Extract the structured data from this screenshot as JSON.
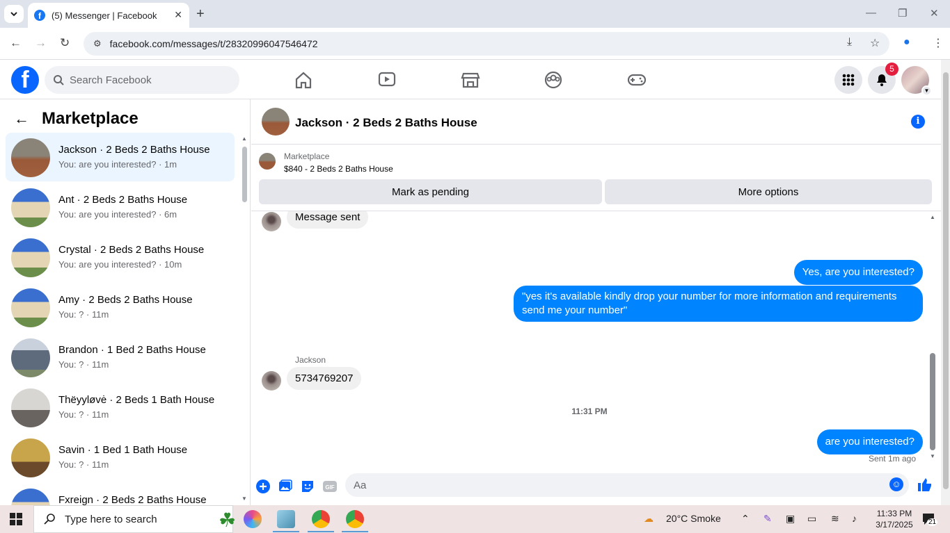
{
  "browser": {
    "tab_title": "(5) Messenger | Facebook",
    "url": "facebook.com/messages/t/28320996047546472"
  },
  "fb": {
    "search_placeholder": "Search Facebook",
    "notification_count": "5",
    "brand_color": "#0866ff"
  },
  "sidebar": {
    "title": "Marketplace",
    "conversations": [
      {
        "name": "Jackson · 2 Beds 2 Baths House",
        "snippet": "You: are you interested? · 1m"
      },
      {
        "name": "Ant · 2 Beds 2 Baths House",
        "snippet": "You: are you interested? · 6m"
      },
      {
        "name": "Crystal · 2 Beds 2 Baths House",
        "snippet": "You: are you interested? · 10m"
      },
      {
        "name": "Amy · 2 Beds 2 Baths House",
        "snippet": "You: ? · 11m"
      },
      {
        "name": "Brandon · 1 Bed 2 Baths House",
        "snippet": "You: ? · 11m"
      },
      {
        "name": "Thëyyløvė · 2 Beds 1 Bath House",
        "snippet": "You: ? · 11m"
      },
      {
        "name": "Savin · 1 Bed 1 Bath House",
        "snippet": "You: ? · 11m"
      },
      {
        "name": "Fxreign · 2 Beds 2 Baths House",
        "snippet": ""
      }
    ]
  },
  "chat": {
    "title": "Jackson · 2 Beds 2 Baths House",
    "marketplace_label": "Marketplace",
    "listing_price": "$840 - 2 Beds 2 Baths House",
    "mark_pending_label": "Mark as pending",
    "more_options_label": "More options",
    "messages": {
      "in_1": "Message sent",
      "out_1": "Yes, are you interested?",
      "out_2": "\"yes it's available kindly drop your number for more information and requirements send me your number\"",
      "sender_name": "Jackson",
      "in_2": "5734769207",
      "timestamp": "11:31 PM",
      "out_3": "are you  interested?",
      "status": "Sent 1m ago"
    },
    "composer_placeholder": "Aa"
  },
  "taskbar": {
    "search_placeholder": "Type here to search",
    "weather": "20°C  Smoke",
    "time": "11:33 PM",
    "date": "3/17/2025",
    "notif_count": "21"
  }
}
